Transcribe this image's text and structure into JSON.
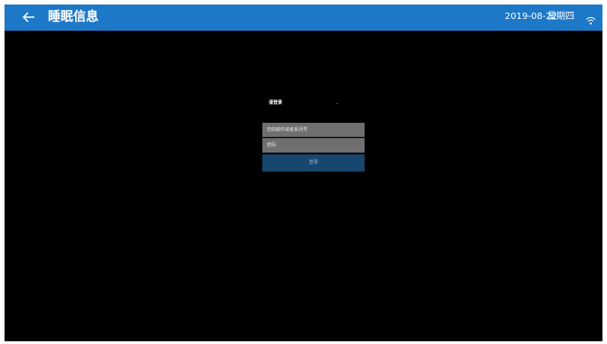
{
  "header": {
    "title": "睡眠信息",
    "date": "2019-08-22",
    "weekday": "星期四",
    "back_icon": "arrow-left-icon",
    "wifi_icon": "wifi-icon"
  },
  "login": {
    "title": "请登录",
    "email_placeholder": "您的邮件或者系列号",
    "password_placeholder": "密码",
    "submit_label": "登录"
  },
  "colors": {
    "header_bg": "#1e78c8",
    "field_bg": "#6f6f6f",
    "button_bg": "#17466e"
  }
}
